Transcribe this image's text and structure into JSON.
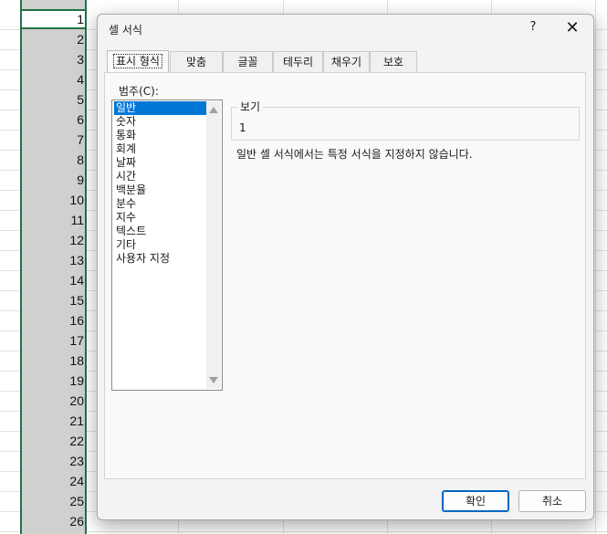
{
  "sheet": {
    "row_numbers": [
      "1",
      "2",
      "3",
      "4",
      "5",
      "6",
      "7",
      "8",
      "9",
      "10",
      "11",
      "12",
      "13",
      "14",
      "15",
      "16",
      "17",
      "18",
      "19",
      "20",
      "21",
      "22",
      "23",
      "24",
      "25",
      "26"
    ]
  },
  "dialog": {
    "title": "셀 서식",
    "help_label": "?",
    "close_label": "✕",
    "tabs": [
      "표시 형식",
      "맞춤",
      "글꼴",
      "테두리",
      "채우기",
      "보호"
    ],
    "category_label": "범주(C):",
    "categories": [
      "일반",
      "숫자",
      "통화",
      "회계",
      "날짜",
      "시간",
      "백분율",
      "분수",
      "지수",
      "텍스트",
      "기타",
      "사용자 지정"
    ],
    "selected_category": "일반",
    "preview_label": "보기",
    "preview_value": "1",
    "description": "일반 셀 서식에서는 특정 서식을 지정하지 않습니다.",
    "ok_label": "확인",
    "cancel_label": "취소",
    "colors": {
      "selection": "#0078d7",
      "sheet_selection": "#217346"
    }
  }
}
